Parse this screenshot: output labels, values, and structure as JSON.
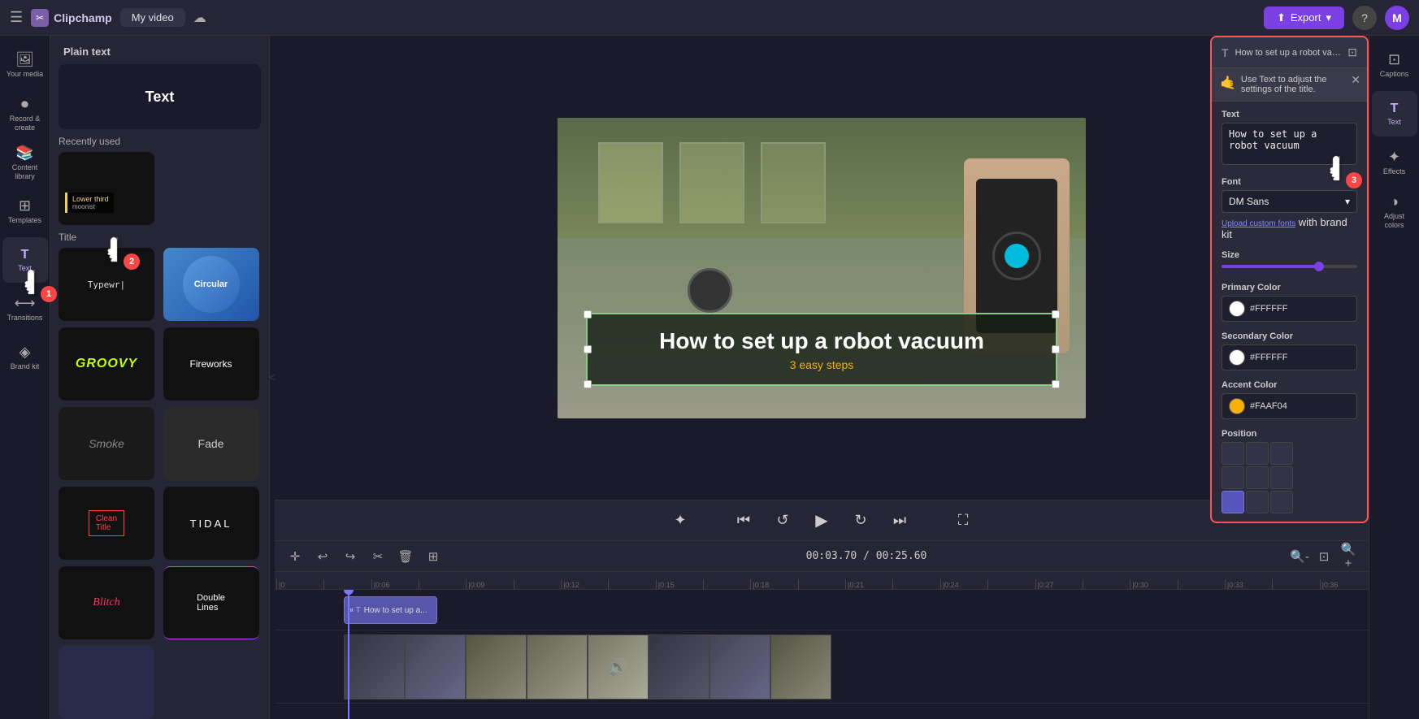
{
  "app": {
    "name": "Clipchamp",
    "video_title": "My video",
    "export_label": "Export"
  },
  "topbar": {
    "help_label": "?",
    "avatar_label": "M"
  },
  "left_panel": {
    "items": [
      {
        "id": "your-media",
        "icon": "🖼",
        "label": "Your media"
      },
      {
        "id": "record-create",
        "icon": "⏺",
        "label": "Record &\ncreate"
      },
      {
        "id": "content-library",
        "icon": "📚",
        "label": "Content\nlibrary"
      },
      {
        "id": "templates",
        "icon": "⊞",
        "label": "Templates"
      },
      {
        "id": "text",
        "icon": "T",
        "label": "Text",
        "active": true
      },
      {
        "id": "transitions",
        "icon": "⟷",
        "label": "Transitions"
      },
      {
        "id": "brand-kit",
        "icon": "◈",
        "label": "Brand kit"
      }
    ]
  },
  "templates_panel": {
    "section_plain_text": "Plain text",
    "section_recently_used": "Recently used",
    "section_title": "Title",
    "cards": [
      {
        "id": "plain-text",
        "label": "Text",
        "style": "plain-text"
      },
      {
        "id": "lower-third",
        "label": "Lower third",
        "style": "lower-third"
      },
      {
        "id": "typewriter",
        "label": "Typewr...",
        "style": "typewriter"
      },
      {
        "id": "circular",
        "label": "Circular",
        "style": "circular"
      },
      {
        "id": "groovy",
        "label": "GROOVY",
        "style": "groovy"
      },
      {
        "id": "fireworks",
        "label": "Fireworks",
        "style": "fireworks"
      },
      {
        "id": "smoke",
        "label": "Smoke",
        "style": "smoke"
      },
      {
        "id": "fade",
        "label": "Fade",
        "style": "fade"
      },
      {
        "id": "clean-title",
        "label": "Clean Title",
        "style": "clean-title"
      },
      {
        "id": "tidal",
        "label": "TIDAL",
        "style": "tidal"
      },
      {
        "id": "glitch",
        "label": "Glitch",
        "style": "glitch"
      },
      {
        "id": "double-lines",
        "label": "Double Lines",
        "style": "double-lines"
      }
    ]
  },
  "video_preview": {
    "aspect_ratio": "16:9",
    "main_text": "How to set up a robot vacuum",
    "sub_text": "3 easy steps"
  },
  "playback": {
    "time_current": "00:03.70",
    "time_total": "00:25.60"
  },
  "timeline": {
    "text_clip_label": "How to set up a...",
    "ruler_marks": [
      "0",
      "",
      "|0:06",
      "",
      "|0:09",
      "",
      "|0:12",
      "",
      "|0:15",
      "",
      "|0:18",
      "",
      "|0:21",
      "",
      "|0:24",
      "",
      "|0:27",
      "",
      "|0:30",
      "",
      "|0:33",
      "",
      "|0:36"
    ]
  },
  "right_panel": {
    "items": [
      {
        "id": "captions",
        "icon": "⊡",
        "label": "Captions"
      },
      {
        "id": "text-right",
        "icon": "T",
        "label": "Text"
      },
      {
        "id": "effects",
        "icon": "✦",
        "label": "Effects"
      },
      {
        "id": "adjust-colors",
        "icon": "◑",
        "label": "Adjust\ncolors"
      }
    ]
  },
  "text_props": {
    "panel_title": "How to set up a robot vacuum 3...",
    "tooltip_text": "Use Text to adjust the settings of the title.",
    "text_label": "Text",
    "text_value": "How to set up a robot vacuum",
    "font_label": "Font",
    "font_value": "DM Sans",
    "upload_fonts_text": "Upload custom fonts",
    "upload_fonts_suffix": " with brand kit",
    "size_label": "Size",
    "primary_color_label": "Primary Color",
    "primary_color_value": "#FFFFFF",
    "secondary_color_label": "Secondary Color",
    "secondary_color_value": "#FFFFFF",
    "accent_color_label": "Accent Color",
    "accent_color_value": "#FAAF04",
    "position_label": "Position"
  }
}
